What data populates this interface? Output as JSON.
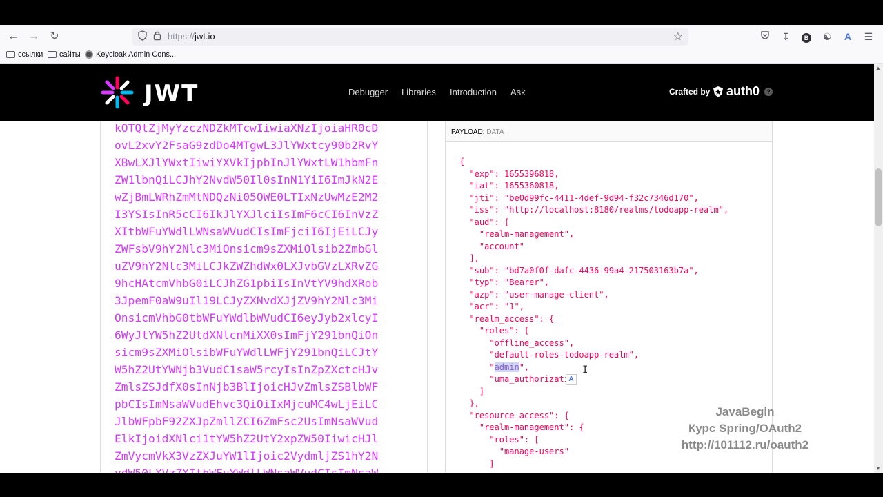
{
  "browser": {
    "url_protocol": "https://",
    "url_host": "jwt.io",
    "bookmarks": [
      {
        "label": "ссылки",
        "icon": "folder-icon"
      },
      {
        "label": "сайты",
        "icon": "folder-icon"
      },
      {
        "label": "Keycloak Admin Cons...",
        "icon": "keycloak-icon"
      }
    ],
    "toolbar_icons": [
      "pocket-icon",
      "download-icon",
      "profile-icon",
      "extensions-icon",
      "translate-icon",
      "menu-icon"
    ],
    "profile_letter": "B"
  },
  "header": {
    "logo_text": "JWT",
    "nav": [
      "Debugger",
      "Libraries",
      "Introduction",
      "Ask"
    ],
    "crafted_by": "Crafted by",
    "auth0": "auth0",
    "help": "?"
  },
  "encoded": {
    "lines": [
      "kOTQtZjMyYzczNDZkMTcwIiwiaXNzIjoiaHR0cD",
      "ovL2xvY2FsaG9zdDo4MTgwL3JlYWxtcy90b2RvY",
      "XBwLXJlYWxtIiwiYXVkIjpbInJlYWxtLW1hbmFn",
      "ZW1lbnQiLCJhY2NvdW50Il0sInN1YiI6ImJkN2E",
      "wZjBmLWRhZmMtNDQzNi05OWE0LTIxNzUwMzE2M2",
      "I3YSIsInR5cCI6IkJlYXJlciIsImF6cCI6InVzZ",
      "XItbWFuYWdlLWNsaWVudCIsImFjciI6IjEiLCJy",
      "ZWFsbV9hY2Nlc3MiOnsicm9sZXMiOlsib2ZmbGl",
      "uZV9hY2Nlc3MiLCJkZWZhdWx0LXJvbGVzLXRvZG",
      "9hcHAtcmVhbG0iLCJhZG1pbiIsInVtYV9hdXRob",
      "3JpemF0aW9uIl19LCJyZXNvdXJjZV9hY2Nlc3Mi",
      "OnsicmVhbG0tbWFuYWdlbWVudCI6eyJyb2xlcyI",
      "6WyJtYW5hZ2UtdXNlcnMiXX0sImFjY291bnQiOn",
      "sicm9sZXMiOlsibWFuYWdlLWFjY291bnQiLCJtY",
      "W5hZ2UtYWNjb3VudC1saW5rcyIsInZpZXctcHJv",
      "ZmlsZSJdfX0sInNjb3BlIjoicHJvZmlsZSBlbWF",
      "pbCIsImNsaWVudEhvc3QiOiIxMjcuMC4wLjEiLC",
      "JlbWFpbF92ZXJpZmllZCI6ZmFsc2UsImNsaWVud",
      "ElkIjoidXNlci1tYW5hZ2UtY2xpZW50IiwicHJl",
      "ZmVycmVkX3VzZXJuYW1lIjoic2VydmljZS1hY2N",
      "vdW50LXVzZXItbWFuYWdlLWNsaWVudCIsImNsaW"
    ]
  },
  "payload": {
    "label": "PAYLOAD:",
    "sublabel": "DATA",
    "lines": [
      "{",
      "  \"exp\": 1655396818,",
      "  \"iat\": 1655360818,",
      "  \"jti\": \"be0d99fc-4411-4def-9d94-f32c7346d170\",",
      "  \"iss\": \"http://localhost:8180/realms/todoapp-realm\",",
      "  \"aud\": [",
      "    \"realm-management\",",
      "    \"account\"",
      "  ],",
      "  \"sub\": \"bd7a0f0f-dafc-4436-99a4-217503163b7a\",",
      "  \"typ\": \"Bearer\",",
      "  \"azp\": \"user-manage-client\",",
      "  \"acr\": \"1\",",
      "  \"realm_access\": {",
      "    \"roles\": [",
      "      \"offline_access\",",
      "      \"default-roles-todoapp-realm\",",
      "      \"admin\",",
      "      \"uma_authorizati",
      "    ]",
      "  },",
      "  \"resource_access\": {",
      "    \"realm-management\": {",
      "      \"roles\": [",
      "        \"manage-users\"",
      "      ]"
    ],
    "highlight_line_index": 17,
    "highlight_text": "admin"
  },
  "watermark": {
    "line1": "JavaBegin",
    "line2": "Курс Spring/OAuth2",
    "line3": "http://101112.ru/oauth2"
  }
}
